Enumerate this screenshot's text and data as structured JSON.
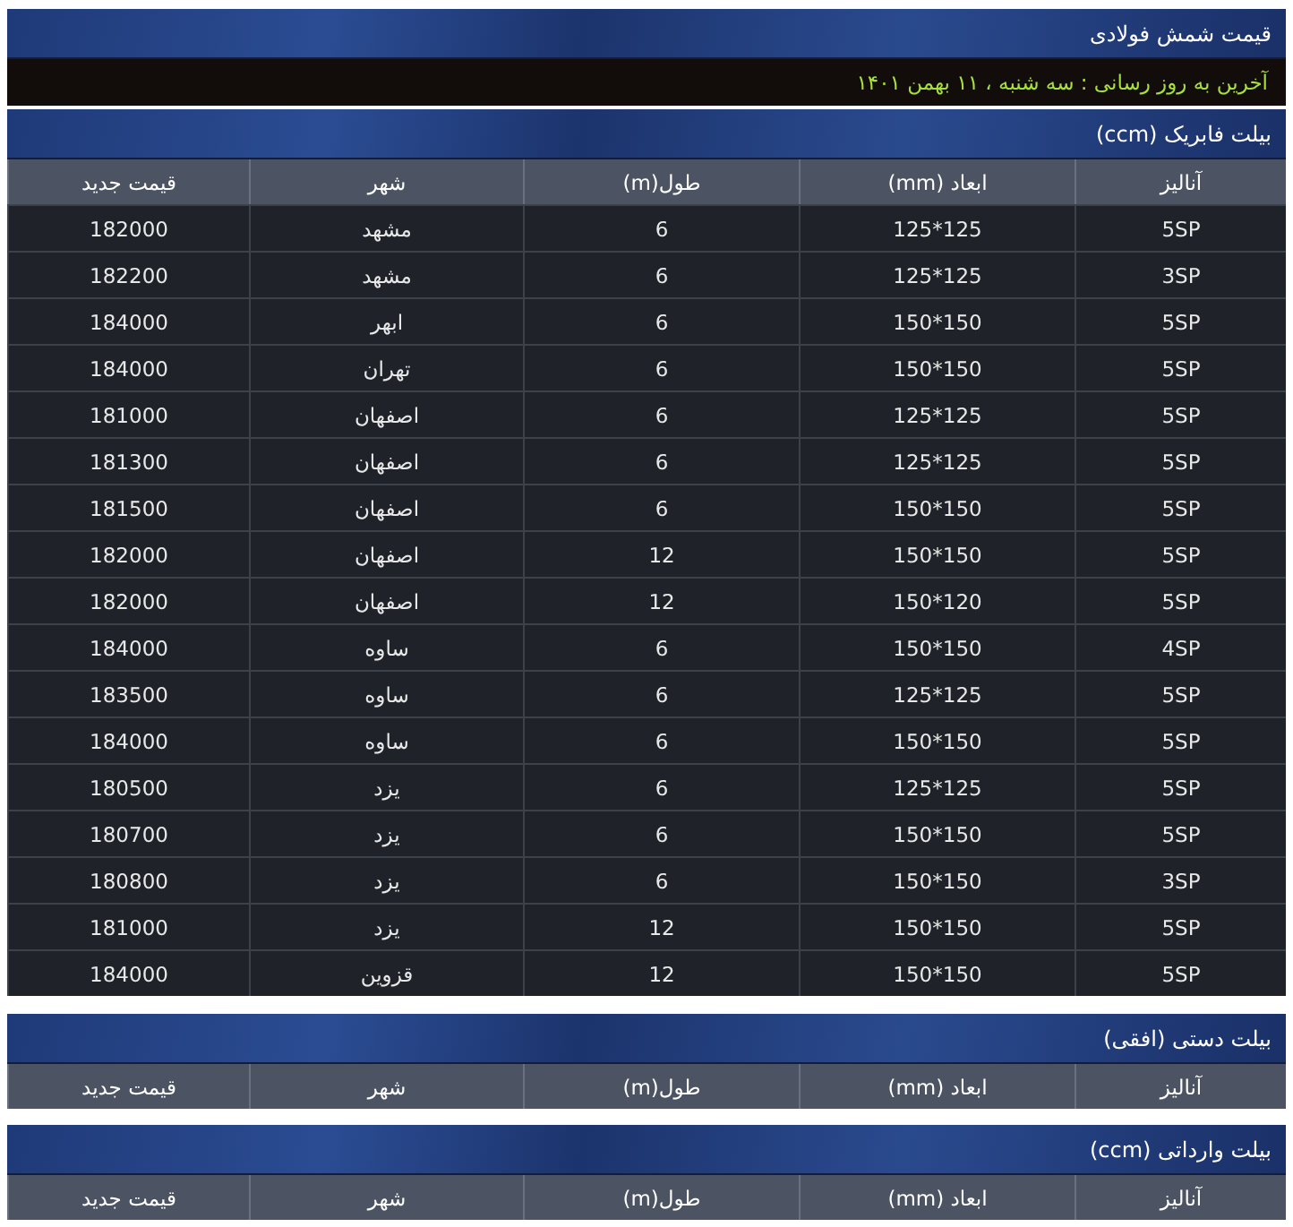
{
  "page_title": "قیمت شمش فولادی",
  "update_note": "آخرین به روز رسانی : سه شنبه ، ۱۱ بهمن ۱۴۰۱",
  "sections": [
    {
      "title": "بیلت فابریک (ccm)",
      "columns": [
        "آنالیز",
        "ابعاد (mm)",
        "طول(m)",
        "شهر",
        "قیمت جدید"
      ],
      "rows": [
        [
          "5SP",
          "125*125",
          "6",
          "مشهد",
          "182000"
        ],
        [
          "3SP",
          "125*125",
          "6",
          "مشهد",
          "182200"
        ],
        [
          "5SP",
          "150*150",
          "6",
          "ابهر",
          "184000"
        ],
        [
          "5SP",
          "150*150",
          "6",
          "تهران",
          "184000"
        ],
        [
          "5SP",
          "125*125",
          "6",
          "اصفهان",
          "181000"
        ],
        [
          "5SP",
          "125*125",
          "6",
          "اصفهان",
          "181300"
        ],
        [
          "5SP",
          "150*150",
          "6",
          "اصفهان",
          "181500"
        ],
        [
          "5SP",
          "150*150",
          "12",
          "اصفهان",
          "182000"
        ],
        [
          "5SP",
          "150*120",
          "12",
          "اصفهان",
          "182000"
        ],
        [
          "4SP",
          "150*150",
          "6",
          "ساوه",
          "184000"
        ],
        [
          "5SP",
          "125*125",
          "6",
          "ساوه",
          "183500"
        ],
        [
          "5SP",
          "150*150",
          "6",
          "ساوه",
          "184000"
        ],
        [
          "5SP",
          "125*125",
          "6",
          "یزد",
          "180500"
        ],
        [
          "5SP",
          "150*150",
          "6",
          "یزد",
          "180700"
        ],
        [
          "3SP",
          "150*150",
          "6",
          "یزد",
          "180800"
        ],
        [
          "5SP",
          "150*150",
          "12",
          "یزد",
          "181000"
        ],
        [
          "5SP",
          "150*150",
          "12",
          "قزوین",
          "184000"
        ]
      ]
    },
    {
      "title": "بیلت دستی (افقی)",
      "columns": [
        "آنالیز",
        "ابعاد (mm)",
        "طول(m)",
        "شهر",
        "قیمت جدید"
      ]
    },
    {
      "title": "بیلت وارداتی (ccm)",
      "columns": [
        "آنالیز",
        "ابعاد (mm)",
        "طول(m)",
        "شهر",
        "قیمت جدید"
      ]
    }
  ]
}
